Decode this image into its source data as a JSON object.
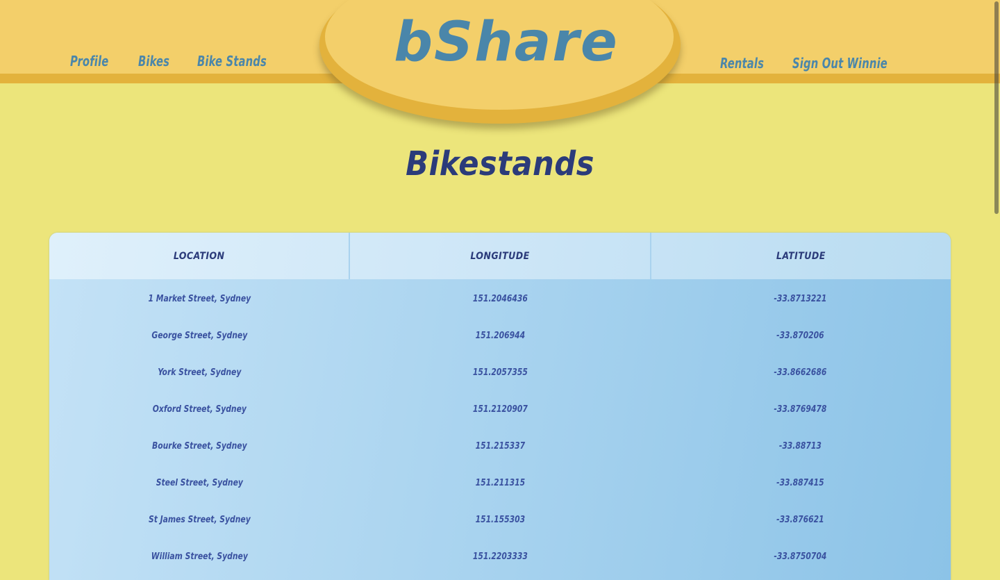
{
  "header": {
    "logo": "bShare",
    "nav_left": [
      {
        "label": "Profile"
      },
      {
        "label": "Bikes"
      },
      {
        "label": "Bike Stands"
      }
    ],
    "nav_right": [
      {
        "label": "Rentals"
      },
      {
        "label": "Sign Out Winnie"
      }
    ]
  },
  "main": {
    "title": "Bikestands"
  },
  "table": {
    "columns": [
      "LOCATION",
      "LONGITUDE",
      "LATITUDE"
    ],
    "rows": [
      [
        "1 Market Street, Sydney",
        "151.2046436",
        "-33.8713221"
      ],
      [
        "George Street, Sydney",
        "151.206944",
        "-33.870206"
      ],
      [
        "York Street, Sydney",
        "151.2057355",
        "-33.8662686"
      ],
      [
        "Oxford Street, Sydney",
        "151.2120907",
        "-33.8769478"
      ],
      [
        "Bourke Street, Sydney",
        "151.215337",
        "-33.88713"
      ],
      [
        "Steel Street, Sydney",
        "151.211315",
        "-33.887415"
      ],
      [
        "St James Street, Sydney",
        "151.155303",
        "-33.876621"
      ],
      [
        "William Street, Sydney",
        "151.2203333",
        "-33.8750704"
      ]
    ]
  },
  "colors": {
    "page_background": "#ece57b",
    "header_band": "#f3cf6a",
    "header_stripe": "#e3b23c",
    "nav_text": "#4a86aa",
    "title_text": "#2b3b7a",
    "table_text": "#3a52a0"
  }
}
